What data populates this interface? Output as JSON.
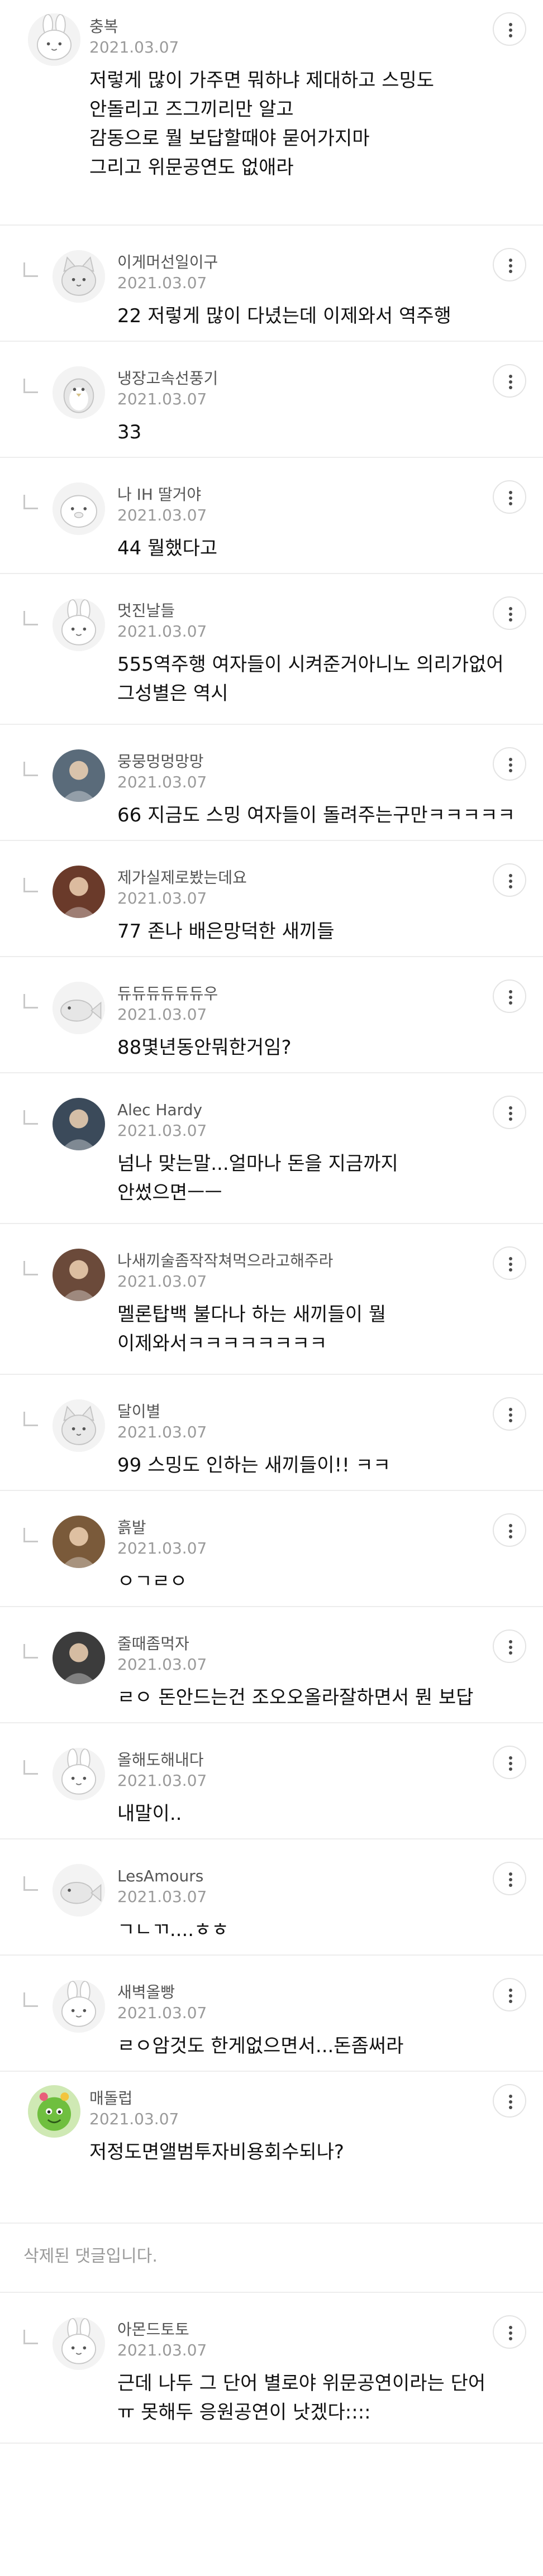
{
  "comments": [
    {
      "kind": "top",
      "nickname": "충복",
      "date": "2021.03.07",
      "avatar": "rabbit-avatar-icon",
      "lines": [
        "저렇게 많이 가주면 뭐하냐 제대하고 스밍도",
        "안돌리고 즈그끼리만 알고",
        "감동으로 뭘 보답할때야 묻어가지마",
        "그리고 위문공연도 없애라"
      ]
    },
    {
      "kind": "reply",
      "nickname": "이게머선일이구",
      "date": "2021.03.07",
      "avatar": "cat-avatar-icon",
      "lines": [
        "22 저렇게 많이 다녔는데 이제와서 역주행"
      ]
    },
    {
      "kind": "reply",
      "nickname": "냉장고속선풍기",
      "date": "2021.03.07",
      "avatar": "penguin-avatar-icon",
      "lines": [
        "33"
      ]
    },
    {
      "kind": "reply",
      "nickname": "나 IH 딸거야",
      "date": "2021.03.07",
      "avatar": "seal-avatar-icon",
      "lines": [
        "44 뭘했다고"
      ]
    },
    {
      "kind": "reply",
      "nickname": "멋진날들",
      "date": "2021.03.07",
      "avatar": "bunny-face-avatar-icon",
      "lines": [
        "555역주행 여자들이 시켜준거아니노 의리가없어",
        "그성별은 역시"
      ]
    },
    {
      "kind": "reply",
      "nickname": "뭉뭉멍멍망망",
      "date": "2021.03.07",
      "avatar": "photo-avatar-icon",
      "lines": [
        "66 지금도 스밍 여자들이 돌려주는구만ㅋㅋㅋㅋㅋ"
      ]
    },
    {
      "kind": "reply",
      "nickname": "제가실제로봤는데요",
      "date": "2021.03.07",
      "avatar": "photo-avatar-icon",
      "lines": [
        "77 존나 배은망덕한 새끼들"
      ]
    },
    {
      "kind": "reply",
      "nickname": "듀듀듀듀듀듀우",
      "date": "2021.03.07",
      "avatar": "fish-avatar-icon",
      "lines": [
        "88몇년동안뭐한거임?"
      ]
    },
    {
      "kind": "reply",
      "nickname": "Alec Hardy",
      "date": "2021.03.07",
      "avatar": "photo-avatar-icon",
      "lines": [
        "넘나 맞는말...얼마나 돈을 지금까지",
        "안썼으면ㅡㅡ"
      ]
    },
    {
      "kind": "reply",
      "nickname": "나새끼술좀작작쳐먹으라고해주라",
      "date": "2021.03.07",
      "avatar": "photo-avatar-icon",
      "lines": [
        "멜론탑백 불다나 하는 새끼들이 뭘",
        "이제와서ㅋㅋㅋㅋㅋㅋㅋㅋ"
      ]
    },
    {
      "kind": "reply",
      "nickname": "달이별",
      "date": "2021.03.07",
      "avatar": "cat-avatar-icon",
      "lines": [
        "99 스밍도 인하는 새끼들이!! ㅋㅋ"
      ]
    },
    {
      "kind": "reply",
      "nickname": "흙발",
      "date": "2021.03.07",
      "avatar": "photo-avatar-icon",
      "lines": [
        "ㅇㄱㄹㅇ"
      ]
    },
    {
      "kind": "reply",
      "nickname": "줄때좀먹자",
      "date": "2021.03.07",
      "avatar": "photo-avatar-icon",
      "lines": [
        "ㄹㅇ 돈안드는건 조오오올라잘하면서 뭔 보답"
      ]
    },
    {
      "kind": "reply",
      "nickname": "올해도해내다",
      "date": "2021.03.07",
      "avatar": "rabbit-avatar-icon",
      "lines": [
        "내말이.."
      ]
    },
    {
      "kind": "reply",
      "nickname": "LesAmours",
      "date": "2021.03.07",
      "avatar": "fish-avatar-icon",
      "lines": [
        "ㄱㄴㄲ....ㅎㅎ"
      ]
    },
    {
      "kind": "reply",
      "nickname": "새벽올빵",
      "date": "2021.03.07",
      "avatar": "rabbit-avatar-icon",
      "lines": [
        "ㄹㅇ암것도 한게없으면서...돈좀써라"
      ]
    },
    {
      "kind": "top",
      "nickname": "매돌럽",
      "date": "2021.03.07",
      "avatar": "green-character-avatar-icon",
      "lines": [
        "저정도면앨범투자비용회수되나?"
      ]
    },
    {
      "kind": "deleted",
      "text": "삭제된 댓글입니다."
    },
    {
      "kind": "reply",
      "nickname": "아몬드토토",
      "date": "2021.03.07",
      "avatar": "bunny-face-avatar-icon",
      "lines": [
        "근데 나두 그 단어 별로야 위문공연이라는 단어",
        "ㅠ 못해두 응원공연이 낫겠다::::"
      ]
    }
  ],
  "ui": {
    "more_button": "more-options"
  }
}
